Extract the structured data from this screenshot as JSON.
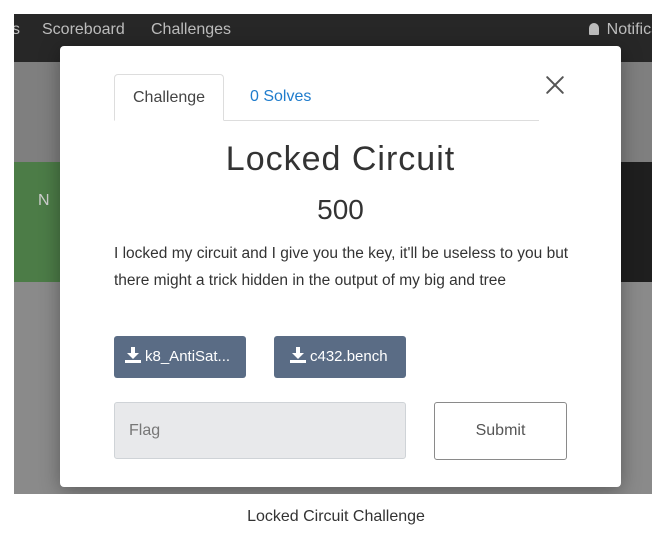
{
  "background_nav": {
    "item_partial_left": "s",
    "scoreboard": "Scoreboard",
    "challenges": "Challenges",
    "notifications_partial": "Notifica",
    "green_item_partial": "N"
  },
  "modal": {
    "tabs": [
      {
        "label": "Challenge",
        "active": true
      },
      {
        "label": "0 Solves",
        "active": false
      }
    ],
    "title": "Locked Circuit",
    "value": "500",
    "description": "I locked my circuit and I give you the key, it'll be useless to you but there might a trick hidden in the output of my big and tree",
    "files": [
      {
        "label": "k8_AntiSat...",
        "icon": "download-icon"
      },
      {
        "label": "c432.bench",
        "icon": "download-icon"
      }
    ],
    "flag_placeholder": "Flag",
    "submit_label": "Submit",
    "close_icon": "close-icon"
  },
  "caption": "Locked Circuit Challenge",
  "colors": {
    "navbar": "#272727",
    "file_button": "#5a6c85",
    "solves_link": "#1f7ccc",
    "green_block": "#4c7c47"
  }
}
